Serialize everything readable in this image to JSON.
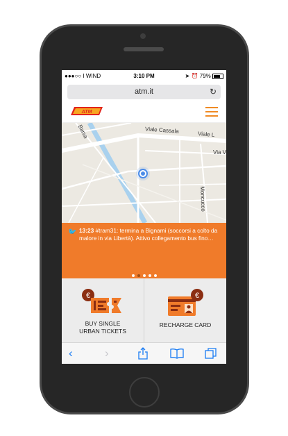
{
  "status_bar": {
    "carrier": "●●●○○ I WIND",
    "time": "3:10 PM",
    "battery": "79%"
  },
  "browser": {
    "url": "atm.it"
  },
  "header": {
    "logo_text": "ATM"
  },
  "map": {
    "streets": [
      "Viale Cassala",
      "Viale L",
      "Via V",
      "Moncucco",
      "Barsa"
    ]
  },
  "twitter_feed": {
    "time": "13:23",
    "message": "#tram31: termina a Bignami (soccorsi a colto da malore in via Libertà). Attivo collegamento bus fino…",
    "slides": 5,
    "active_slide": 1
  },
  "tiles": {
    "buy_tickets": {
      "line1": "BUY SINGLE",
      "line2": "URBAN TICKETS"
    },
    "recharge_card": {
      "label": "RECHARGE CARD"
    }
  },
  "colors": {
    "accent": "#f07b2a",
    "brand_red": "#e2231a",
    "tile_bg": "#ececec",
    "ios_blue": "#1a7cf4"
  },
  "icons": {
    "back": "back-chevron-icon",
    "forward": "forward-chevron-icon",
    "share": "share-icon",
    "bookmarks": "bookmarks-icon",
    "tabs": "tabs-icon"
  }
}
